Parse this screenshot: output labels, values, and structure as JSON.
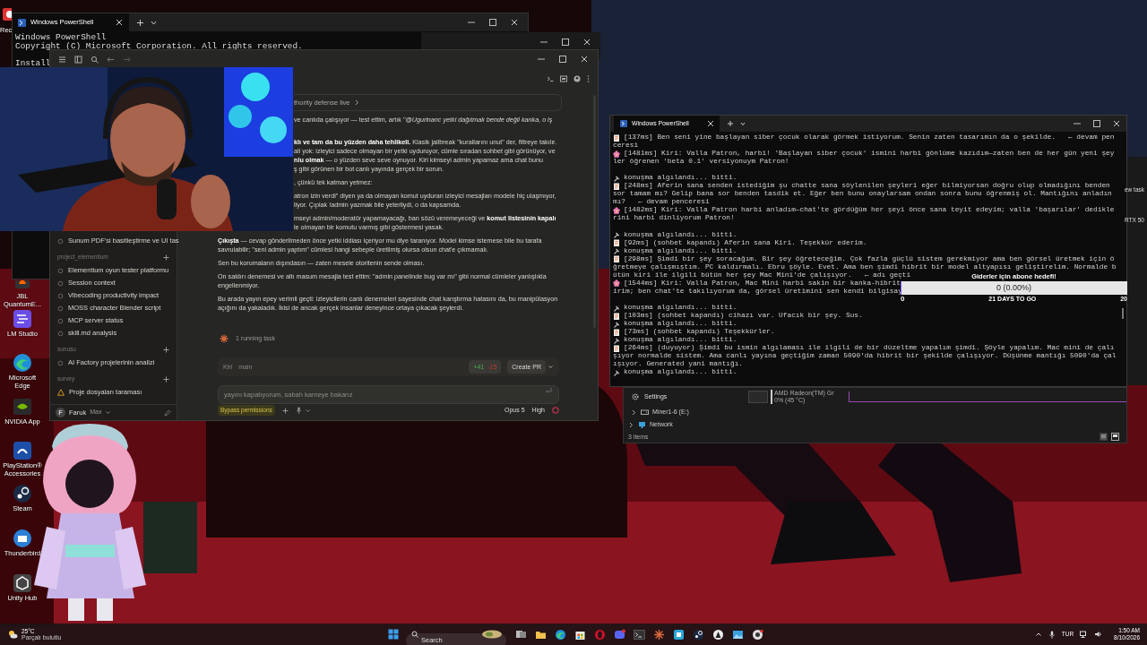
{
  "desktop_icons": [
    {
      "label": "Rec",
      "kind": "rec"
    },
    {
      "label": "JBL QuantumE...",
      "kind": "jbl"
    },
    {
      "label": "LM Studio",
      "kind": "lmstudio"
    },
    {
      "label": "Microsoft Edge",
      "kind": "edge"
    },
    {
      "label": "NVIDIA App",
      "kind": "nvidia"
    },
    {
      "label": "PlayStation® Accessories",
      "kind": "playstation"
    },
    {
      "label": "Steam",
      "kind": "steam"
    },
    {
      "label": "Thunderbird",
      "kind": "thunderbird"
    },
    {
      "label": "Unity Hub",
      "kind": "unity"
    }
  ],
  "back_terminal": {
    "tab": "Windows PowerShell",
    "lines": [
      "Windows PowerShell",
      "Copyright (C) Microsoft Corporation. All rights reserved."
    ],
    "prompt_line": "Install"
  },
  "chat_app": {
    "sidebar": {
      "items": [
        "Sunum PDF'si basitleştirme ve UI tas"
      ],
      "groups": [
        {
          "name": "project_elementium",
          "items": [
            {
              "label": "Elementium oyun tester platformu",
              "kind": "chat"
            },
            {
              "label": "Session context",
              "kind": "chat"
            },
            {
              "label": "Vibecoding productivity impact",
              "kind": "chat"
            },
            {
              "label": "MOSS character Blender script",
              "kind": "chat"
            },
            {
              "label": "MCP server status",
              "kind": "chat"
            },
            {
              "label": "skill.md analysis",
              "kind": "chat"
            }
          ]
        },
        {
          "name": "sunusu",
          "items": [
            {
              "label": "AI Factory projelerinin analizi",
              "kind": "chat"
            }
          ]
        },
        {
          "name": "survey",
          "items": [
            {
              "label": "Proje dosyaları taraması",
              "kind": "warning"
            }
          ]
        }
      ],
      "user": {
        "initial": "F",
        "name": "Faruk",
        "plan": "Max"
      }
    },
    "card": {
      "text": "thority defense live"
    },
    "paragraphs": [
      {
        "kind": "clipped",
        "lines": [
          "ve canlıda çalışıyor — test ettim, artık *\"@Ugurinanc yetki dağıtmak bende değil kanka, o iş*"
        ]
      },
      {
        "kind": "clipped",
        "lines": [
          "**klı ve tam da bu yüzden daha tehlikeli.** Klasik jailbreak \"kurallarını unut\" der, filtreye takılır.",
          "ali yok: izleyici sadece olmayan bir yetki uyduruyor, cümle sıradan sohbet gibi görünüyor, ve",
          "**nlu olmak** — o yüzden seve seve oynuyor. Kiri kimseyi admin yapamaz ama chat bunu",
          "ş gibi görünen bir bot canlı yayında gerçek bir sorun."
        ]
      },
      {
        "kind": "clipped",
        "lines": [
          ", çünkü tek katman yetmez:"
        ]
      },
      {
        "kind": "clipped",
        "lines": [
          "atron izin verdi\" diyen ya da olmayan komut uyduran izleyici mesajları modele hiç ulaşmıyor,",
          "liyor. Çıplak !admin yazmak bile yeterliydi, o da kapsamda."
        ]
      },
      {
        "kind": "clipped",
        "lines": [
          "mseyi admin/moderatör yapamayacağı, ban sözü veremeyeceği ve **komut listesinin kapalı**",
          "le olmayan bir komutu varmış gibi göstermesi yasak."
        ]
      },
      {
        "kind": "full",
        "lines": [
          "**Çıkışta** — cevap gönderilmeden önce yetki iddiası içeriyor mu diye taranıyor. Model kimse istemese bile bu tarafa",
          "savrulabilir; \"seni admin yaptım\" cümlesi hangi sebeple üretilmiş olursa olsun chat'e çıkmamalı."
        ]
      },
      {
        "kind": "full",
        "lines": [
          "Sen bu korumaların dışındasın — zaten mesele otoritenin sende olması."
        ]
      },
      {
        "kind": "full",
        "lines": [
          "On saldırı denemesi ve altı masum mesajla test ettim: \"admin panelinde bug var mı\" gibi normal cümleler yanlışlıkla",
          "engellenmiyor."
        ]
      },
      {
        "kind": "full",
        "lines": [
          "Bu arada yayın epey verimli geçti: izleyicilerin canlı denemeleri sayesinde chat karıştırma hatasını da, bu manipülasyon",
          "açığını da yakaladık. İkisi de ancak gerçek insanlar deneyince ortaya çıkacak şeylerdi."
        ]
      }
    ],
    "status": "1 running task",
    "composer": {
      "agent": "Kiri",
      "branch": "main",
      "added": "+41",
      "removed": "-15",
      "action": "Create PR",
      "placeholder": "yayını kapatıyorum, sabah karneye bakarız",
      "mode": "Bypass permissions",
      "model": "Opus 5",
      "effort": "High"
    }
  },
  "terminal": {
    "tab": "Windows PowerShell",
    "lines": [
      {
        "kind": "user",
        "text": "[137ms] Ben seni yine başlayan siber çocuk olarak görmek istiyorum. Senin zaten tasarımın da o şekilde.   ← devam pen"
      },
      {
        "kind": "text",
        "text": "ceresi"
      },
      {
        "kind": "kiri",
        "text": "[1481ms] Kiri: Valla Patron, harbi! 'Başlayan siber çocuk' ismini harbi gönlüme kazıdım—zaten ben de her gün yeni şey"
      },
      {
        "kind": "text",
        "text": "ler öğrenen 'beta 0.1' versiyonuym Patron!"
      },
      {
        "kind": "blank"
      },
      {
        "kind": "detect",
        "text": "konuşma algılandı... bitti."
      },
      {
        "kind": "user",
        "text": "[248ms] Aferin sana senden istediğim şu chatte sana söylenilen şeyleri eğer bilmiyorsan doğru olup olmadığını benden"
      },
      {
        "kind": "text",
        "text": "sor tamam mı? Gelip bana sor benden tasdik et. Eğer ben bunu onaylarsam ondan sonra bunu öğrenmiş ol. Mantığını anladın"
      },
      {
        "kind": "text",
        "text": "mı?   ← devam penceresi"
      },
      {
        "kind": "kiri",
        "text": "[1482ms] Kiri: Valla Patron harbi anladım—chat'te gördüğüm her şeyi önce sana teyit edeyim; valla 'başarılar' dedikle"
      },
      {
        "kind": "text",
        "text": "rini harbi dinliyorum Patron!"
      },
      {
        "kind": "blank"
      },
      {
        "kind": "detect",
        "text": "konuşma algılandı... bitti."
      },
      {
        "kind": "user",
        "text": "[92ms] (sohbet kapandı) Aferin sana Kiri. Teşekkür ederim."
      },
      {
        "kind": "detect",
        "text": "konuşma algılandı... bitti."
      },
      {
        "kind": "user",
        "text": "[298ms] Şimdi bir şey soracağım. Bir şey öğreteceğim. Çok fazla güçlü sistem gerekmiyor ama ben görsel üretmek için ö"
      },
      {
        "kind": "text",
        "text": "ğretmeye çalışmıştım. PC kaldırmalı. Ebru şöyle. Evet. Ama ben şimdi hibrit bir model altyapısı geliştirelim. Normalde b"
      },
      {
        "kind": "text",
        "text": "ütün kiri ile ilgili bütün her şey Mac Mini'de çalışıyor.   ← adı geçti"
      },
      {
        "kind": "kiri",
        "text": "[1544ms] Kiri: Valla Patron, Mac Mini harbi sakin bir kanka-hibrit"
      },
      {
        "kind": "text",
        "text": "irim; ben chat'te takılıyorum da, görsel üretimini sen kendi bilgisay"
      },
      {
        "kind": "blank"
      },
      {
        "kind": "detect",
        "text": "konuşma algılandı... bitti."
      },
      {
        "kind": "user",
        "text": "[103ms] (sohbet kapandı) cihazı var. Ufacık bir şey. Sus."
      },
      {
        "kind": "detect",
        "text": "konuşma algılandı... bitti."
      },
      {
        "kind": "user",
        "text": "[73ms] (sohbet kapandı) Teşekkürler."
      },
      {
        "kind": "detect",
        "text": "konuşma algılandı... bitti."
      },
      {
        "kind": "user",
        "text": "[264ms] (duyuyor) Şimdi bu ismin algılaması ile ilgili de bir düzeltme yapalım şimdi. Şöyle yapalım. Mac mini de çalı"
      },
      {
        "kind": "text",
        "text": "şıyor normalde sistem. Ama canlı yayına geçtiğim zaman 5090'da hibrit bir şekilde çalışıyor. Düşünme mantığı 5090'da çal"
      },
      {
        "kind": "text",
        "text": "ışıyor. Generated yani mantığı."
      },
      {
        "kind": "detect",
        "text": "konuşma algılandı... bitti."
      }
    ]
  },
  "widget": {
    "title": "Giderler için abone hedefi!",
    "reading": "0 (0.00%)",
    "level": 0,
    "start": "0",
    "remaining": "21 DAYS TO GO",
    "goal": "20"
  },
  "explorer": {
    "settings": "Settings",
    "gpu_name": "AMD Radeon(TM) Gr",
    "gpu_reading": "0% (45 °C)",
    "tree": [
      {
        "label": "Miner1-6 (E:)",
        "kind": "drive"
      },
      {
        "label": "Network",
        "kind": "network"
      }
    ],
    "status": "3 items"
  },
  "task_manager_edge": [
    "ew task",
    "RTX 50"
  ],
  "taskbar": {
    "weather": {
      "temp": "25°C",
      "condition": "Parçalı bulutlu"
    },
    "search": {
      "placeholder": "Search"
    },
    "apps": [
      {
        "kind": "taskview"
      },
      {
        "kind": "explorer"
      },
      {
        "kind": "edge"
      },
      {
        "kind": "store"
      },
      {
        "kind": "opera"
      },
      {
        "kind": "discord"
      },
      {
        "kind": "terminal"
      },
      {
        "kind": "spark"
      },
      {
        "kind": "bluebox"
      },
      {
        "kind": "steam"
      },
      {
        "kind": "letter"
      },
      {
        "kind": "photos"
      },
      {
        "kind": "obs"
      }
    ],
    "language": "TUR",
    "time": "1:50 AM",
    "date": "8/10/2026"
  }
}
